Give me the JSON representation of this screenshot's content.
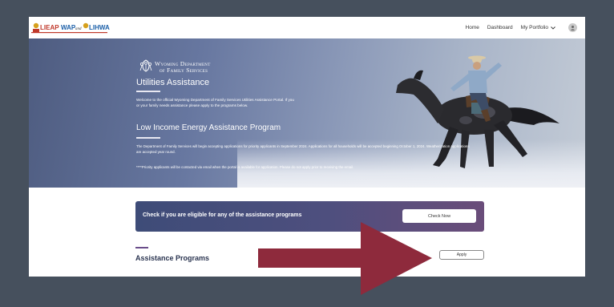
{
  "header": {
    "logo_left_text": "LIEAP",
    "logo_mid_text": "WAP",
    "logo_and": "and",
    "logo_right_text": "LIHWAP",
    "nav": {
      "home": "Home",
      "dashboard": "Dashboard",
      "portfolio": "My Portfolio"
    }
  },
  "hero": {
    "dept_line1": "Wyoming Department",
    "dept_line2": "of Family Services",
    "title": "Utilities Assistance",
    "welcome": "Welcome to the official Wyoming Department of Family Services Utilities Assistance Portal. If you or your family needs assistance please apply to the programs below.",
    "program_title": "Low Income Energy Assistance Program",
    "announcement": "The Department of Family Services will begin accepting applications for priority applicants in September 2024. Applications for all households will be accepted beginning October 1, 2024. Weatherization applications are accepted year round.",
    "priority_note": "****Priority applicants will be contacted via email when the portal is available for application. Please do not apply prior to receiving the email."
  },
  "eligibility": {
    "text": "Check if you are eligible for any of the assistance programs",
    "button": "Check Now"
  },
  "programs": {
    "title": "Assistance Programs",
    "apply_button": "Apply"
  },
  "colors": {
    "page_bg": "#46505d",
    "banner_start": "#3e4c78",
    "banner_end": "#6a4d7a",
    "arrow": "#8e2a3c"
  }
}
